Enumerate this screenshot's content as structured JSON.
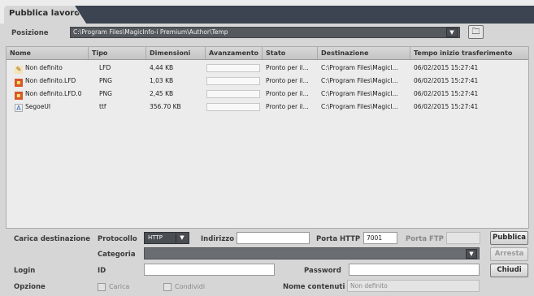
{
  "window": {
    "title": "Pubblica lavoro"
  },
  "position": {
    "label": "Posizione",
    "path": "C:\\Program Files\\MagicInfo-i Premium\\Author\\Temp"
  },
  "table": {
    "headers": [
      "Nome",
      "Tipo",
      "Dimensioni",
      "Avanzamento",
      "Stato",
      "Destinazione",
      "Tempo inizio trasferimento"
    ],
    "rows": [
      {
        "icon": "lfd-file-icon",
        "name": "Non definito",
        "type": "LFD",
        "size": "4,44 KB",
        "progress": 0,
        "status": "Pronto per il...",
        "destination": "C:\\Program Files\\MagicI...",
        "start_time": "06/02/2015 15:27:41"
      },
      {
        "icon": "png-file-icon",
        "name": "Non definito.LFD",
        "type": "PNG",
        "size": "1,03 KB",
        "progress": 0,
        "status": "Pronto per il...",
        "destination": "C:\\Program Files\\MagicI...",
        "start_time": "06/02/2015 15:27:41"
      },
      {
        "icon": "png-file-icon",
        "name": "Non definito.LFD.0",
        "type": "PNG",
        "size": "2,45 KB",
        "progress": 0,
        "status": "Pronto per il...",
        "destination": "C:\\Program Files\\MagicI...",
        "start_time": "06/02/2015 15:27:41"
      },
      {
        "icon": "ttf-file-icon",
        "name": "SegoeUI",
        "type": "ttf",
        "size": "356.70 KB",
        "progress": 0,
        "status": "Pronto per il...",
        "destination": "C:\\Program Files\\MagicI...",
        "start_time": "06/02/2015 15:27:41"
      }
    ]
  },
  "upload": {
    "label": "Carica destinazione",
    "protocol_label": "Protocollo",
    "protocol_value": "HTTP",
    "address_label": "Indirizzo",
    "address_value": "",
    "http_port_label": "Porta HTTP",
    "http_port_value": "7001",
    "ftp_port_label": "Porta FTP",
    "ftp_port_value": "",
    "category_label": "Categoria",
    "category_value": ""
  },
  "login": {
    "label": "Login",
    "id_label": "ID",
    "id_value": "",
    "password_label": "Password",
    "password_value": ""
  },
  "options": {
    "label": "Opzione",
    "upload_checkbox": "Carica",
    "share_checkbox": "Condividi",
    "content_name_label": "Nome contenuti",
    "content_name_placeholder": "Non definito"
  },
  "buttons": {
    "publish": "Pubblica",
    "stop": "Arresta",
    "close": "Chiudi"
  },
  "icons": {
    "folder": "folder-browse-icon",
    "dropdown": "chevron-down-icon"
  }
}
